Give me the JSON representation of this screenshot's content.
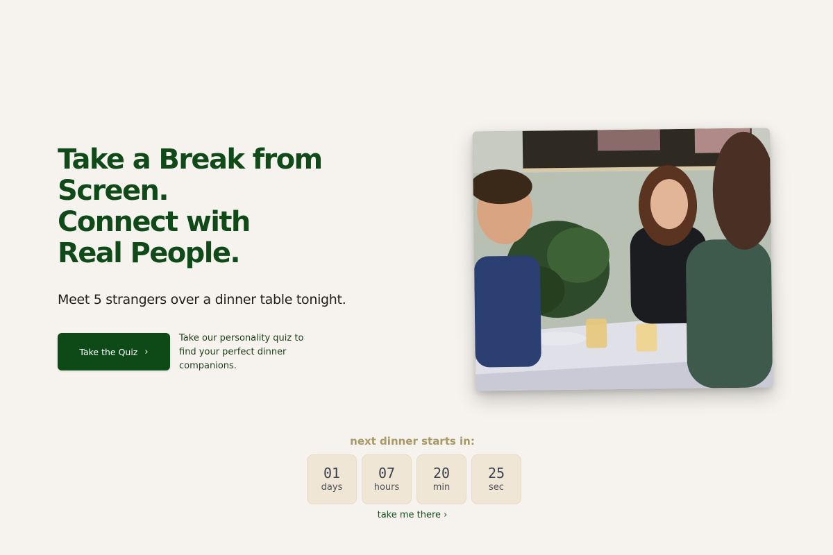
{
  "hero": {
    "title_lines": [
      "Take a Break from",
      "Screen.",
      "Connect with",
      "Real People."
    ],
    "subtitle": "Meet 5 strangers over a dinner table tonight."
  },
  "cta": {
    "button_label": "Take the Quiz",
    "button_icon": "chevron-right-icon",
    "note": "Take our personality quiz to find your perfect dinner companions."
  },
  "photo": {
    "alt": "Friends laughing around a dinner table"
  },
  "countdown": {
    "label": "next dinner starts in:",
    "units": [
      {
        "value": "01",
        "unit": "days"
      },
      {
        "value": "07",
        "unit": "hours"
      },
      {
        "value": "20",
        "unit": "min"
      },
      {
        "value": "25",
        "unit": "sec"
      }
    ],
    "link_label": "take me there ›"
  },
  "colors": {
    "background": "#f6f3ee",
    "brand_green": "#0d4a18",
    "countdown_label": "#a89866",
    "countdown_box": "#f0e6d6"
  }
}
